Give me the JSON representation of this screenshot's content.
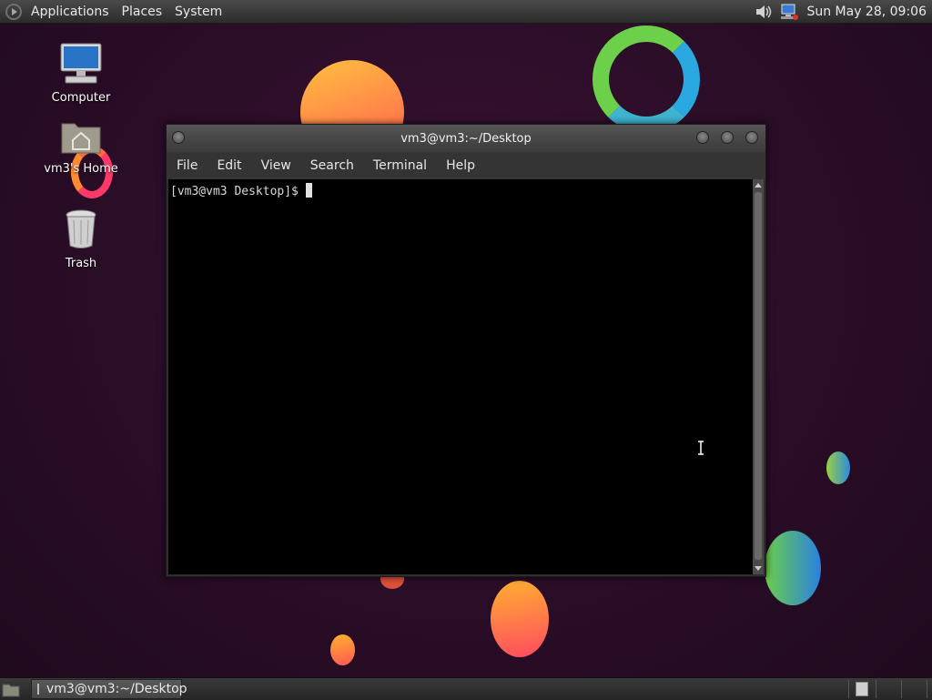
{
  "top_panel": {
    "menus": [
      "Applications",
      "Places",
      "System"
    ],
    "clock": "Sun May 28, 09:06",
    "tray_icons": [
      "volume-icon",
      "network-icon"
    ]
  },
  "desktop_icons": [
    {
      "label": "Computer",
      "icon": "computer-icon"
    },
    {
      "label": "vm3's Home",
      "icon": "home-folder-icon"
    },
    {
      "label": "Trash",
      "icon": "trash-icon"
    }
  ],
  "terminal": {
    "title": "vm3@vm3:~/Desktop",
    "menu": [
      "File",
      "Edit",
      "View",
      "Search",
      "Terminal",
      "Help"
    ],
    "prompt": "[vm3@vm3 Desktop]$"
  },
  "taskbar": {
    "tasks": [
      {
        "label": "vm3@vm3:~/Desktop",
        "icon": "terminal-icon"
      }
    ]
  },
  "colors": {
    "desktop_bg": "#2a0d27",
    "panel": "#3a3a3a",
    "terminal_bg": "#000000"
  }
}
